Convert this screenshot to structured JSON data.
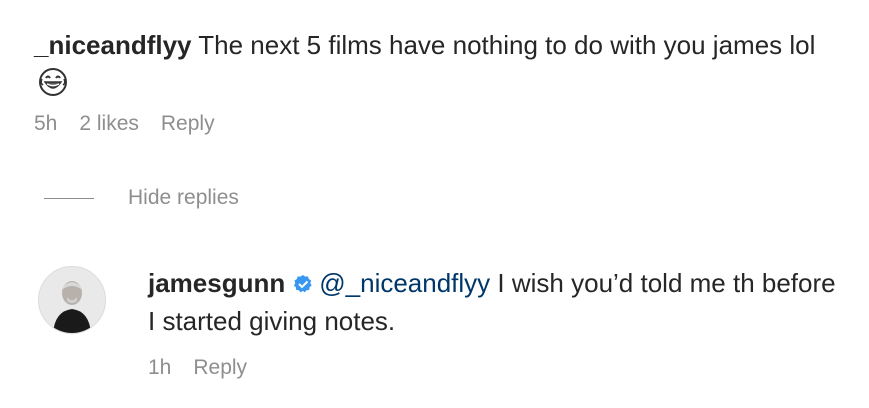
{
  "comment": {
    "username": "_niceandflyy",
    "text": "The next 5 films have nothing to do with you james lol",
    "emoji": "laughing-crying-emoji",
    "time": "5h",
    "likes": "2 likes",
    "reply_label": "Reply"
  },
  "replies_toggle": {
    "label": "Hide replies"
  },
  "reply": {
    "username": "jamesgunn",
    "verified": "verified-badge-icon",
    "mention": "@_niceandflyy",
    "text": "I wish you’d told me th before I started giving notes.",
    "time": "1h",
    "reply_label": "Reply"
  },
  "colors": {
    "text": "#262626",
    "secondary": "#8e8e8e",
    "mention": "#00376b",
    "verified": "#3897f0"
  }
}
